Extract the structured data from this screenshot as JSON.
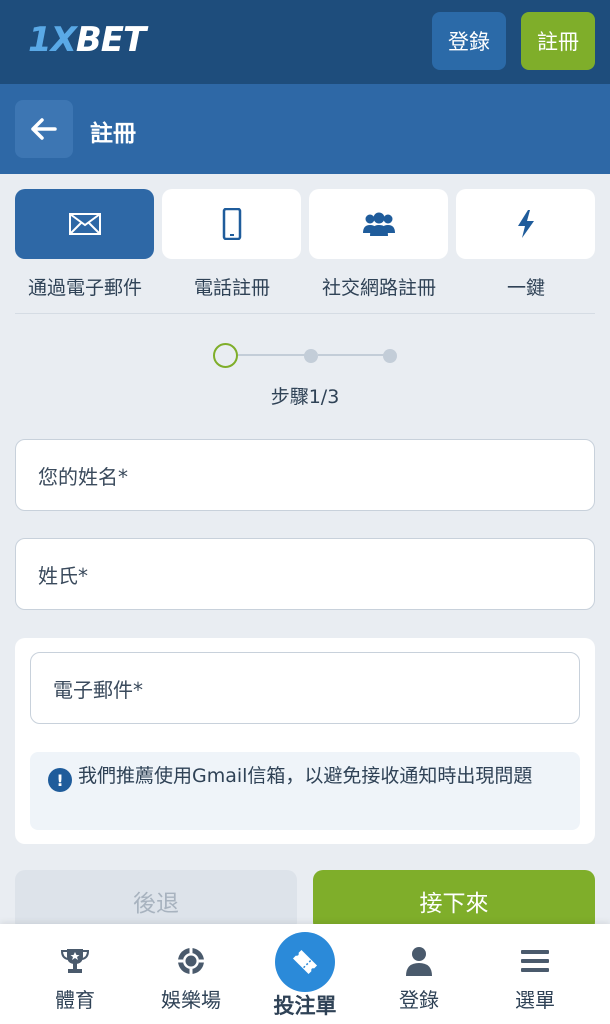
{
  "header": {
    "logo_main": "1XBET",
    "login_label": "登錄",
    "register_label": "註冊",
    "colors": {
      "header_bg": "#1e4d7c",
      "primary": "#2e68a6",
      "accent_green": "#7fae2a"
    }
  },
  "title_bar": {
    "back_icon": "arrow-left-icon",
    "title": "註冊"
  },
  "methods": [
    {
      "label": "通過電子郵件",
      "icon": "envelope-icon",
      "active": true
    },
    {
      "label": "電話註冊",
      "icon": "phone-icon",
      "active": false
    },
    {
      "label": "社交網路註冊",
      "icon": "users-icon",
      "active": false
    },
    {
      "label": "一鍵",
      "icon": "lightning-icon",
      "active": false
    }
  ],
  "stepper": {
    "current_step": 1,
    "total_steps": 3,
    "label": "步驟1/3"
  },
  "form": {
    "first_name_placeholder": "您的姓名*",
    "last_name_placeholder": "姓氏*",
    "email_placeholder": "電子郵件*",
    "notice_icon": "info-icon",
    "notice_text": "我們推薦使用Gmail信箱，以避免接收通知時出現問題"
  },
  "actions": {
    "back_label": "後退",
    "next_label": "接下來"
  },
  "bottom_nav": {
    "items": [
      {
        "label": "體育",
        "icon": "trophy-icon"
      },
      {
        "label": "娛樂場",
        "icon": "casino-chip-icon"
      },
      {
        "label": "投注單",
        "icon": "ticket-icon"
      },
      {
        "label": "登錄",
        "icon": "user-icon"
      },
      {
        "label": "選單",
        "icon": "menu-icon"
      }
    ]
  }
}
